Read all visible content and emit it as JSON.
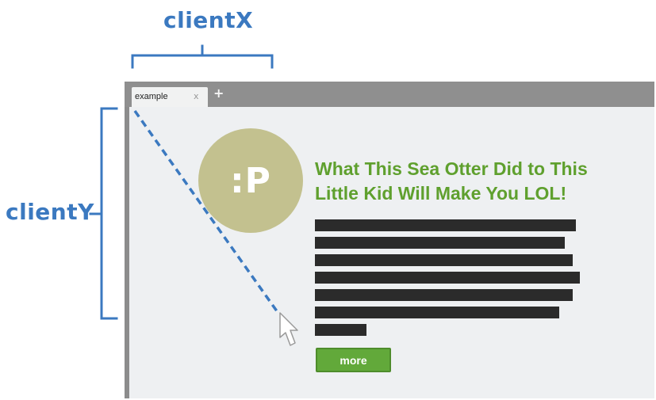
{
  "annotations": {
    "x_label": "clientX",
    "y_label": "clientY"
  },
  "browser": {
    "tab_title": "example",
    "tab_close": "x",
    "new_tab": "+"
  },
  "page": {
    "avatar_text": ":P",
    "headline_line1": "What This Sea Otter Did to This",
    "headline_line2": "Little Kid Will Make You LOL!",
    "placeholder_line_count": 7,
    "more_label": "more"
  },
  "colors": {
    "annotation_blue": "#3b79c0",
    "headline_green": "#5fa02e",
    "button_green": "#62a93a",
    "avatar_olive": "#c3c18f",
    "window_gray": "#8c8c8c",
    "page_background": "#eef0f2"
  },
  "icons": {
    "pointer": "mouse-cursor-arrow-icon"
  }
}
